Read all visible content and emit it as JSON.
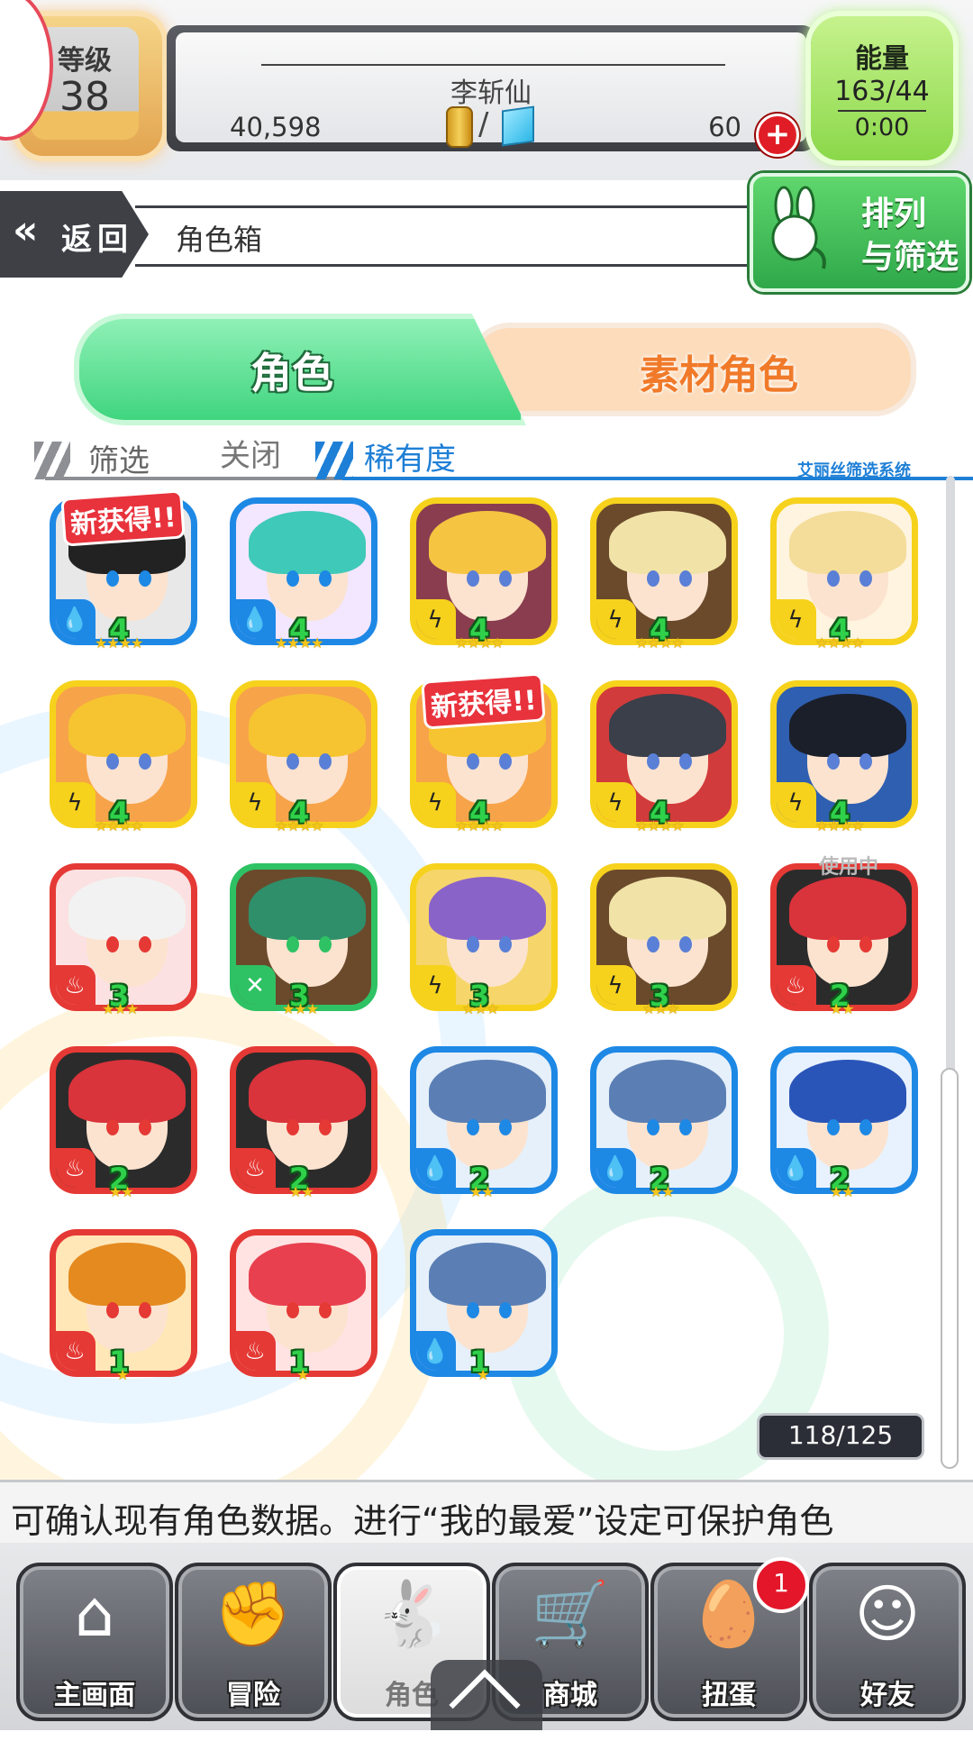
{
  "header": {
    "level_label": "等级",
    "level_value": "38",
    "player_name": "李斩仙",
    "coins": "40,598",
    "currency_separator": "/",
    "gems": "60",
    "plus_symbol": "+",
    "energy_label": "能量",
    "energy_value": "163/44",
    "energy_timer": "0:00"
  },
  "nav_bar": {
    "back_label": "返回",
    "page_title": "角色箱",
    "sort_filter_line1": "排列",
    "sort_filter_line2": "与筛选"
  },
  "tabs": [
    {
      "label": "角色",
      "active": true
    },
    {
      "label": "素材角色",
      "active": false
    }
  ],
  "filter": {
    "filter_label": "筛选",
    "filter_state": "关闭",
    "sort_label": "稀有度",
    "system_tag": "艾丽丝筛选系统"
  },
  "colors": {
    "water": "#1e88e5",
    "thunder": "#f6d21c",
    "fire": "#e53935",
    "wood": "#2ec264"
  },
  "cards": [
    {
      "element": "water",
      "level": "4",
      "stars": "★★★★",
      "badge": "新获得!!",
      "hair": "#222",
      "art": "#e8e8e8"
    },
    {
      "element": "water",
      "level": "4",
      "stars": "★★★★",
      "badge": "",
      "hair": "#3fc9b8",
      "art": "#f3e6ff"
    },
    {
      "element": "thunder",
      "level": "4",
      "stars": "★★★★",
      "badge": "",
      "hair": "#f5c542",
      "art": "#8a3d4f"
    },
    {
      "element": "thunder",
      "level": "4",
      "stars": "★★★★",
      "badge": "",
      "hair": "#f1e3a8",
      "art": "#6b4a2c"
    },
    {
      "element": "thunder",
      "level": "4",
      "stars": "★★★★",
      "badge": "",
      "hair": "#f4dd9a",
      "art": "#fff4e0"
    },
    {
      "element": "thunder",
      "level": "4",
      "stars": "★★★★",
      "badge": "",
      "hair": "#f6c431",
      "art": "#f7a34a"
    },
    {
      "element": "thunder",
      "level": "4",
      "stars": "★★★★",
      "badge": "",
      "hair": "#f6c431",
      "art": "#f7a34a"
    },
    {
      "element": "thunder",
      "level": "4",
      "stars": "★★★★",
      "badge": "新获得!!",
      "hair": "#f6c431",
      "art": "#f7a34a"
    },
    {
      "element": "thunder",
      "level": "4",
      "stars": "★★★★",
      "badge": "",
      "hair": "#3a3f4a",
      "art": "#d23b3b"
    },
    {
      "element": "thunder",
      "level": "4",
      "stars": "★★★★",
      "badge": "",
      "hair": "#1b1f2a",
      "art": "#2f5fb0"
    },
    {
      "element": "fire",
      "level": "3",
      "stars": "★★★",
      "badge": "",
      "hair": "#f2f2f2",
      "art": "#fbe1e1"
    },
    {
      "element": "wood",
      "level": "3",
      "stars": "★★★",
      "badge": "",
      "hair": "#2e8f6a",
      "art": "#6b4a2c"
    },
    {
      "element": "thunder",
      "level": "3",
      "stars": "★★★",
      "badge": "",
      "hair": "#8a63c9",
      "art": "#f6d66a"
    },
    {
      "element": "thunder",
      "level": "3",
      "stars": "★★★",
      "badge": "",
      "hair": "#f1e3a8",
      "art": "#6b4a2c"
    },
    {
      "element": "fire",
      "level": "2",
      "stars": "★★",
      "badge": "",
      "hair": "#d9333b",
      "art": "#2b2b2b",
      "status": "使用中"
    },
    {
      "element": "fire",
      "level": "2",
      "stars": "★★",
      "badge": "",
      "hair": "#d9333b",
      "art": "#2b2b2b"
    },
    {
      "element": "fire",
      "level": "2",
      "stars": "★★",
      "badge": "",
      "hair": "#d9333b",
      "art": "#2b2b2b"
    },
    {
      "element": "water",
      "level": "2",
      "stars": "★★",
      "badge": "",
      "hair": "#5b7fb4",
      "art": "#e6f0fa"
    },
    {
      "element": "water",
      "level": "2",
      "stars": "★★",
      "badge": "",
      "hair": "#5b7fb4",
      "art": "#e6f0fa"
    },
    {
      "element": "water",
      "level": "2",
      "stars": "★★",
      "badge": "",
      "hair": "#2a55b8",
      "art": "#e8f2ff"
    },
    {
      "element": "fire",
      "level": "1",
      "stars": "★",
      "badge": "",
      "hair": "#e58a1f",
      "art": "#ffe7b8"
    },
    {
      "element": "fire",
      "level": "1",
      "stars": "★",
      "badge": "",
      "hair": "#e8404f",
      "art": "#ffe3e3"
    },
    {
      "element": "water",
      "level": "1",
      "stars": "★",
      "badge": "",
      "hair": "#5b7fb4",
      "art": "#e6f0fa"
    }
  ],
  "element_glyphs": {
    "water": "💧",
    "thunder": "ϟ",
    "fire": "♨",
    "wood": "✕"
  },
  "box_count": "118/125",
  "ticker_text": "可确认现有角色数据。进行“我的最爱”设定可保护角色",
  "bottom_nav": [
    {
      "label": "主画面",
      "icon": "home-icon",
      "glyph": "⌂",
      "active": false,
      "badge": ""
    },
    {
      "label": "冒险",
      "icon": "handshake-icon",
      "glyph": "✊",
      "active": false,
      "badge": ""
    },
    {
      "label": "角色",
      "icon": "rabbit-icon",
      "glyph": "🐇",
      "active": true,
      "badge": ""
    },
    {
      "label": "商城",
      "icon": "cart-icon",
      "glyph": "🛒",
      "active": false,
      "badge": ""
    },
    {
      "label": "扭蛋",
      "icon": "egg-icon",
      "glyph": "🥚",
      "active": false,
      "badge": "1"
    },
    {
      "label": "好友",
      "icon": "friends-icon",
      "glyph": "☺",
      "active": false,
      "badge": ""
    }
  ]
}
